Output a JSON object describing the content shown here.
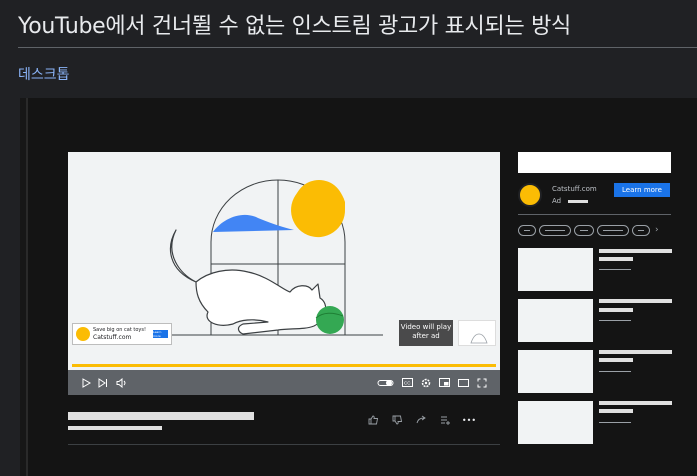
{
  "page": {
    "title": "YouTube에서 건너뛸 수 없는 인스트림 광고가 표시되는 방식",
    "section_tab": "데스크톱"
  },
  "player": {
    "sponsor_card": {
      "line1": "Save big on cat toys!",
      "line2": "Catstuff.com",
      "button": "Learn more"
    },
    "countdown_label_line1": "Video will play",
    "countdown_label_line2": "after ad",
    "progress_value": 1.0,
    "controls": {
      "play_icon": "play-icon",
      "next_icon": "next-icon",
      "volume_icon": "volume-icon",
      "autoplay_icon": "autoplay-toggle-icon",
      "cc_icon": "captions-icon",
      "settings_icon": "gear-icon",
      "miniplayer_icon": "miniplayer-icon",
      "theater_icon": "theater-icon",
      "fullscreen_icon": "fullscreen-icon"
    }
  },
  "video_actions": {
    "like_icon": "thumb-up-icon",
    "dislike_icon": "thumb-down-icon",
    "share_icon": "share-icon",
    "save_icon": "add-to-playlist-icon",
    "more_icon": "more-icon",
    "more_glyph": "•••"
  },
  "sidebar": {
    "companion_ad": {
      "site": "Catstuff.com",
      "ad_label": "Ad",
      "button": "Learn more"
    },
    "chips_next": "›"
  },
  "colors": {
    "background": "#202124",
    "accent_link": "#8ab4f8",
    "brand_yellow": "#fbbc04",
    "cta_blue": "#1a73e8"
  }
}
